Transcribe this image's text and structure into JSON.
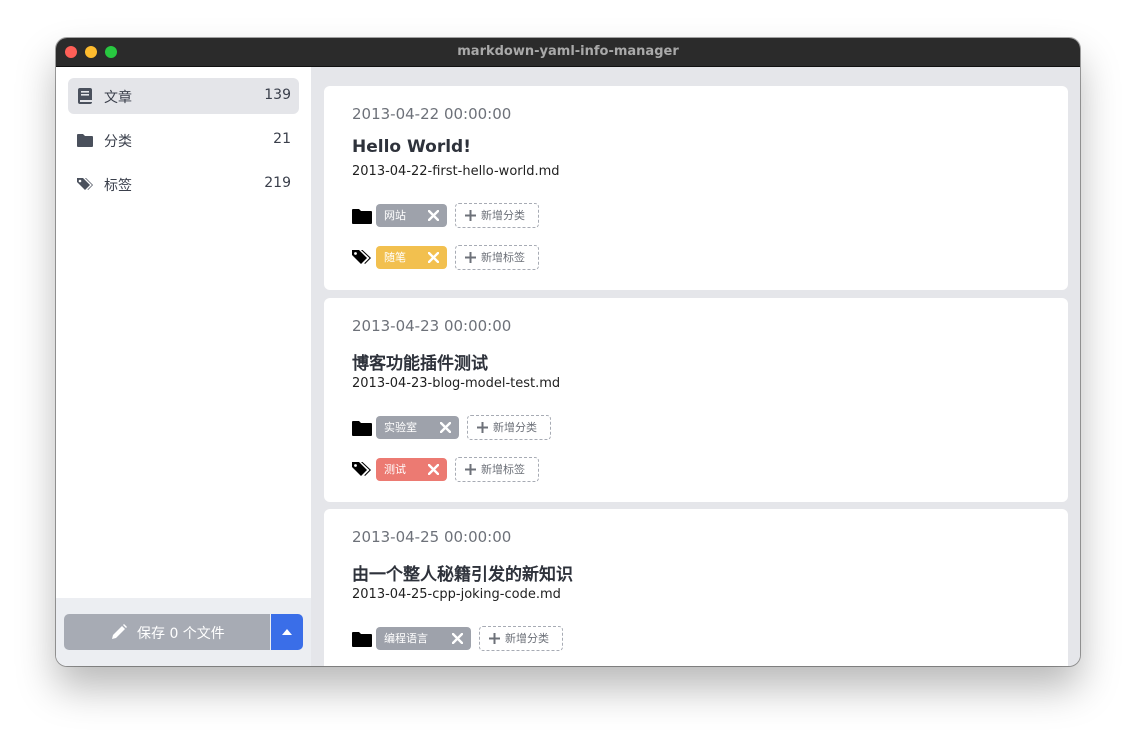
{
  "window": {
    "title": "markdown-yaml-info-manager"
  },
  "sidebar": {
    "items": [
      {
        "label": "文章",
        "count": "139",
        "icon": "book-icon",
        "active": true
      },
      {
        "label": "分类",
        "count": "21",
        "icon": "folder-icon",
        "active": false
      },
      {
        "label": "标签",
        "count": "219",
        "icon": "tags-icon",
        "active": false
      }
    ],
    "save_label": "保存 0 个文件",
    "save_icon": "pencil-icon",
    "menu_icon": "caret-up-icon"
  },
  "colors": {
    "accent": "#3a6ee8",
    "chip_gray": "#9ea2ab",
    "chip_yellow": "#f2c04f",
    "chip_red": "#ec7a72"
  },
  "posts": [
    {
      "date": "2013-04-22 00:00:00",
      "title": "Hello World!",
      "file": "2013-04-22-first-hello-world.md",
      "category": "网站",
      "tag": "随笔",
      "tag_color": "yellow",
      "add_category": "新增分类",
      "add_tag": "新增标签"
    },
    {
      "date": "2013-04-23 00:00:00",
      "title": "博客功能插件测试",
      "file": "2013-04-23-blog-model-test.md",
      "category": "实验室",
      "tag": "测试",
      "tag_color": "red",
      "add_category": "新增分类",
      "add_tag": "新增标签"
    },
    {
      "date": "2013-04-25 00:00:00",
      "title": "由一个整人秘籍引发的新知识",
      "file": "2013-04-25-cpp-joking-code.md",
      "category": "编程语言",
      "add_category": "新增分类"
    }
  ]
}
